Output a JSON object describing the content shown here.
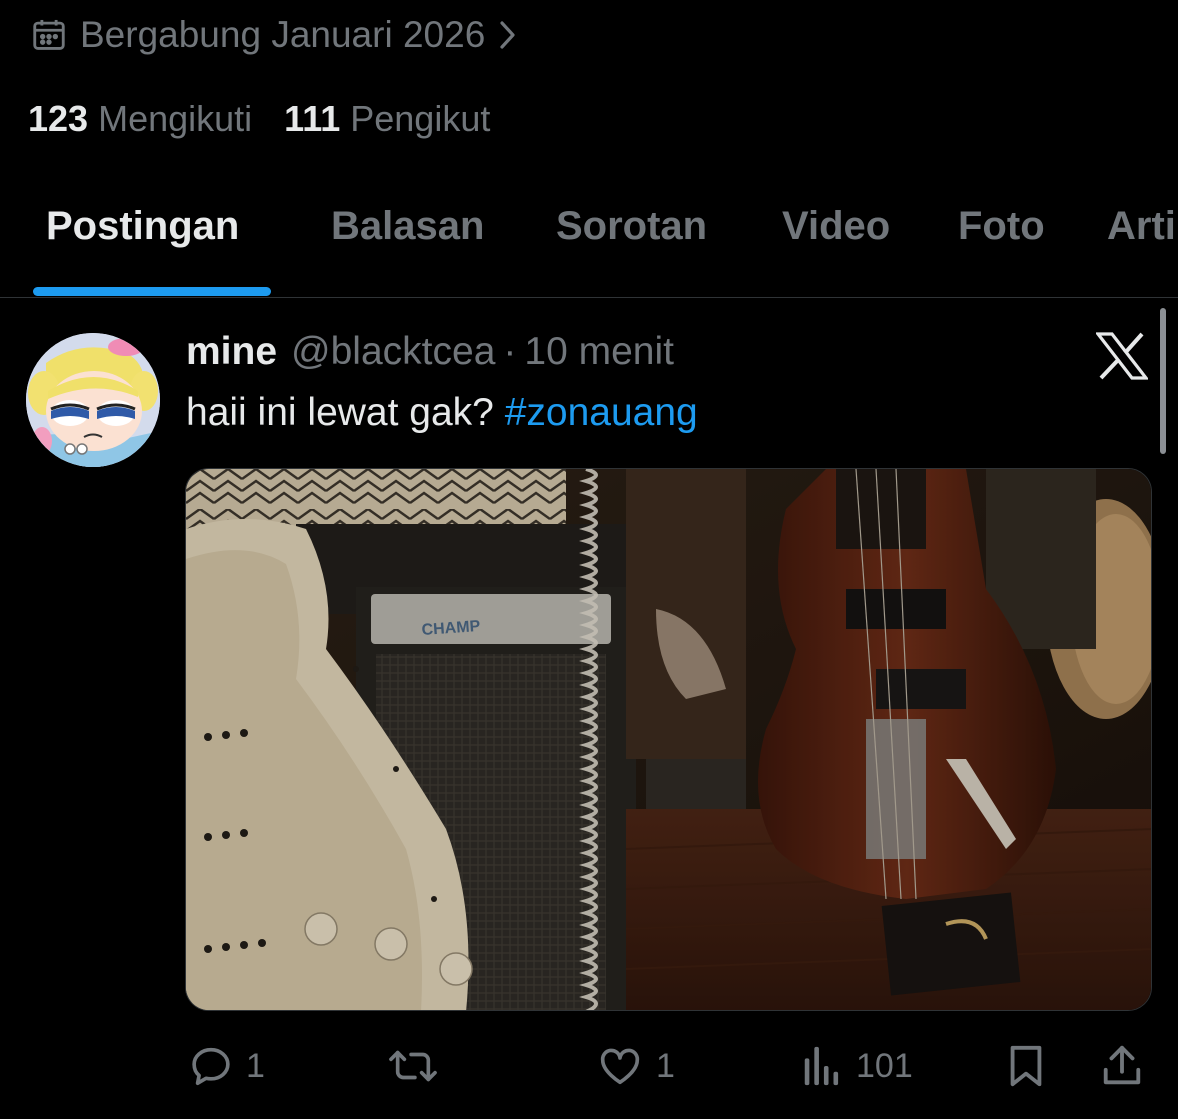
{
  "profile": {
    "joined_text": "Bergabung Januari 2026",
    "following_count": "123",
    "following_label": "Mengikuti",
    "followers_count": "111",
    "followers_label": "Pengikut"
  },
  "tabs": [
    {
      "label": "Postingan",
      "active": true
    },
    {
      "label": "Balasan",
      "active": false
    },
    {
      "label": "Sorotan",
      "active": false
    },
    {
      "label": "Video",
      "active": false
    },
    {
      "label": "Foto",
      "active": false
    },
    {
      "label": "Artikel",
      "active": false
    }
  ],
  "post": {
    "display_name": "mine",
    "handle": "@blacktcea",
    "separator": "·",
    "time": "10 menit",
    "text": "haii ini lewat gak? ",
    "hashtag": "#zonauang",
    "media": {
      "amp_label": "CHAMP"
    },
    "actions": {
      "reply_count": "1",
      "like_count": "1",
      "view_count": "101"
    }
  },
  "colors": {
    "background": "#000000",
    "text_primary": "#e7e9ea",
    "text_secondary": "#71767b",
    "accent": "#1d9bf0",
    "divider": "#2f3336"
  },
  "icons": [
    "calendar-icon",
    "chevron-right-icon",
    "x-logo-icon",
    "reply-icon",
    "repost-icon",
    "like-icon",
    "views-icon",
    "bookmark-icon",
    "share-icon"
  ]
}
